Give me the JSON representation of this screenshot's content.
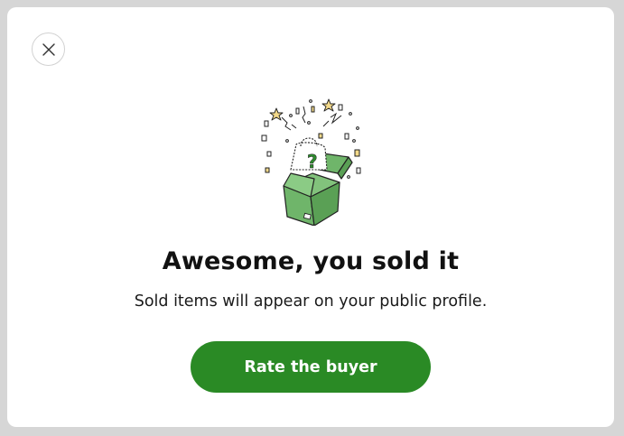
{
  "dialog": {
    "title": "Awesome, you sold it",
    "subtitle": "Sold items will appear on your public profile.",
    "primary_button_label": "Rate the buyer",
    "close_icon": "close-icon",
    "illustration": "open-box-with-mystery-bag-and-confetti"
  },
  "colors": {
    "backdrop": "#d6d6d6",
    "surface": "#ffffff",
    "primary": "#2a8a25",
    "box_green": "#6fb56a",
    "confetti": "#f3d98a"
  }
}
